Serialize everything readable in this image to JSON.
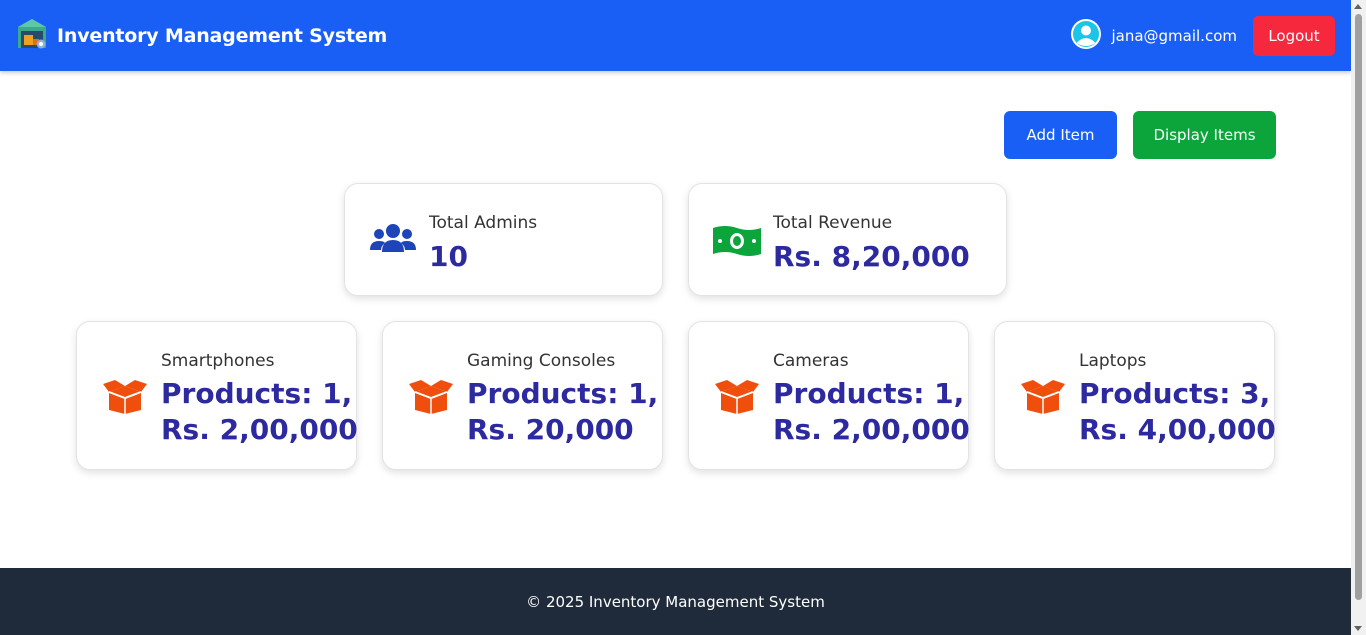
{
  "header": {
    "title": "Inventory Management System",
    "logo_icon": "warehouse-icon",
    "user_icon": "user-avatar-icon",
    "user_email": "jana@gmail.com",
    "logout_label": "Logout"
  },
  "actions": {
    "add_item_label": "Add Item",
    "display_items_label": "Display Items"
  },
  "stats": [
    {
      "label": "Total Admins",
      "value": "10",
      "icon": "users-icon"
    },
    {
      "label": "Total Revenue",
      "value": "Rs. 8,20,000",
      "icon": "money-icon"
    }
  ],
  "categories": [
    {
      "name": "Smartphones",
      "line1": "Products: 1,",
      "line2": "Rs. 2,00,000",
      "icon": "box-icon"
    },
    {
      "name": "Gaming Consoles",
      "line1": "Products: 1,",
      "line2": "Rs. 20,000",
      "icon": "box-icon"
    },
    {
      "name": "Cameras",
      "line1": "Products: 1,",
      "line2": "Rs. 2,00,000",
      "icon": "box-icon"
    },
    {
      "name": "Laptops",
      "line1": "Products: 3,",
      "line2": "Rs. 4,00,000",
      "icon": "box-icon"
    }
  ],
  "footer": {
    "text": "© 2025 Inventory Management System"
  },
  "colors": {
    "primary": "#1a5ff5",
    "danger": "#f5283e",
    "success": "#0ba53c",
    "value_text": "#2d2aa0",
    "box_icon": "#f04e0c",
    "footer_bg": "#1f2a3b"
  }
}
